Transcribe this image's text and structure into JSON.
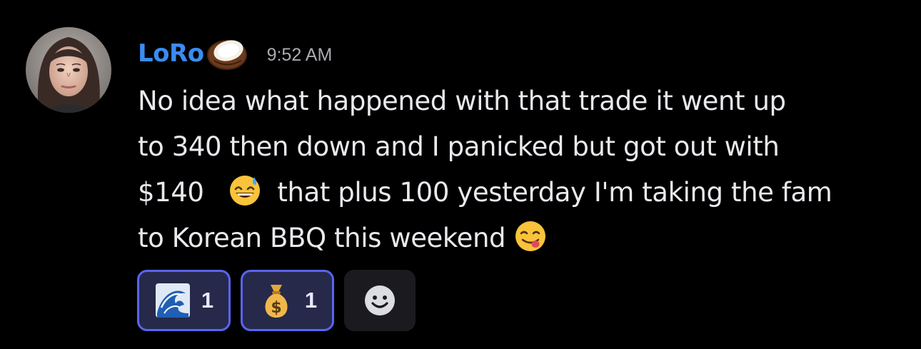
{
  "message": {
    "author": "LoRo",
    "author_emoji": "coconut-icon",
    "timestamp": "9:52 AM",
    "lines": [
      "No idea what happened with that trade it went up",
      "to 340 then down and I panicked but got out with",
      "$140",
      "that plus 100 yesterday I'm taking the fam",
      "to Korean BBQ this weekend"
    ],
    "inline_emojis": [
      "grinning-sweat-icon",
      "yum-face-icon"
    ]
  },
  "reactions": [
    {
      "icon": "wave-icon",
      "count": "1"
    },
    {
      "icon": "money-bag-icon",
      "count": "1"
    }
  ],
  "add_reaction_icon": "smiley-face-icon",
  "colors": {
    "background": "#000000",
    "username": "#3b8cf0",
    "timestamp": "#a9abb0",
    "reaction_border": "#5865f2",
    "reaction_bg": "#26294a",
    "add_reaction_bg": "#1b1b1f"
  }
}
